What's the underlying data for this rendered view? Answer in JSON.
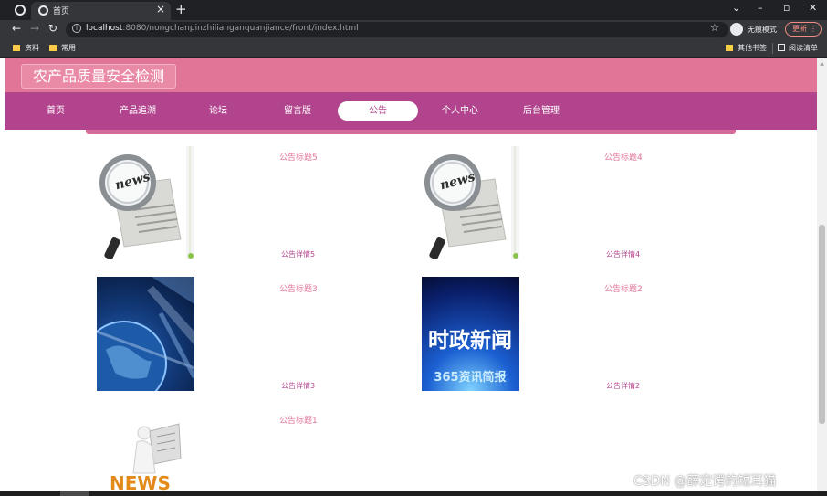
{
  "browser": {
    "tab_title": "首页",
    "url_host": "localhost",
    "url_rest": ":8080/nongchanpinzhilianganquanjiance/front/index.html",
    "incognito_label": "无痕模式",
    "update_label": "更新",
    "bookmarks": [
      "资料",
      "常用"
    ],
    "other_bookmarks": "其他书签",
    "reading_list": "阅读清单"
  },
  "site": {
    "title": "农产品质量安全检测",
    "nav": [
      {
        "label": "首页",
        "active": false
      },
      {
        "label": "产品追溯",
        "active": false
      },
      {
        "label": "论坛",
        "active": false
      },
      {
        "label": "留言版",
        "active": false
      },
      {
        "label": "公告",
        "active": true
      },
      {
        "label": "个人中心",
        "active": false
      },
      {
        "label": "后台管理",
        "active": false
      }
    ]
  },
  "notices": [
    {
      "title": "公告标题5",
      "detail": "公告详情5",
      "image": "news-magnifier-icon"
    },
    {
      "title": "公告标题4",
      "detail": "公告详情4",
      "image": "news-magnifier-icon"
    },
    {
      "title": "公告标题3",
      "detail": "公告详情3",
      "image": "globe-icon"
    },
    {
      "title": "公告标题2",
      "detail": "公告详情2",
      "image": "political-news-banner",
      "banner_line1": "时政新闻",
      "banner_line2": "365资讯简报"
    },
    {
      "title": "公告标题1",
      "detail": "",
      "image": "news-reader-figure",
      "figure_text": "NEWS"
    }
  ],
  "watermark": "CSDN @薛定谔的短耳猫",
  "colors": {
    "header": "#e07597",
    "nav": "#b1448c",
    "title_text": "#e07597",
    "detail_text": "#b1448c"
  }
}
